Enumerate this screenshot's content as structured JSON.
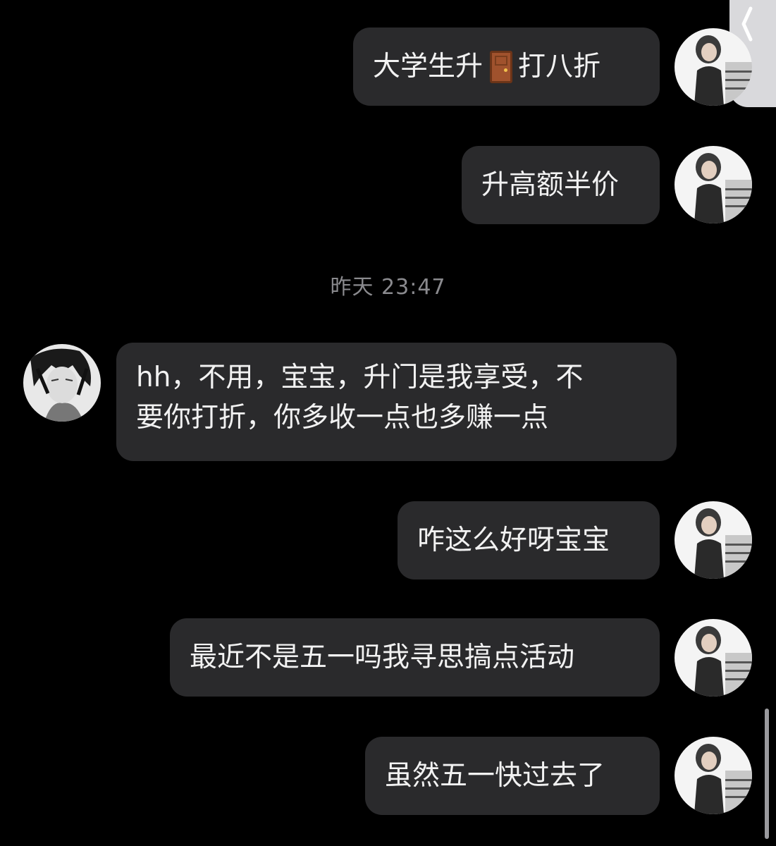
{
  "timestamp": "昨天 23:47",
  "messages": [
    {
      "sender": "me",
      "text_before": "大学生升",
      "icon": "door-icon",
      "text_after": "打八折"
    },
    {
      "sender": "me",
      "text": "升高额半价"
    },
    {
      "sender": "other",
      "line1": "hh，不用，宝宝，升门是我享受，不",
      "line2": "要你打折，你多收一点也多赚一点"
    },
    {
      "sender": "me",
      "text": "咋这么好呀宝宝"
    },
    {
      "sender": "me",
      "text": "最近不是五一吗我寻思搞点活动"
    },
    {
      "sender": "me",
      "text": "虽然五一快过去了"
    }
  ],
  "colors": {
    "background": "#000000",
    "bubble": "#2a2a2c",
    "text": "#f2f2f2",
    "timestamp": "#8a8a8e"
  },
  "icons": {
    "back": "chevron-left-icon",
    "door": "door-icon"
  }
}
